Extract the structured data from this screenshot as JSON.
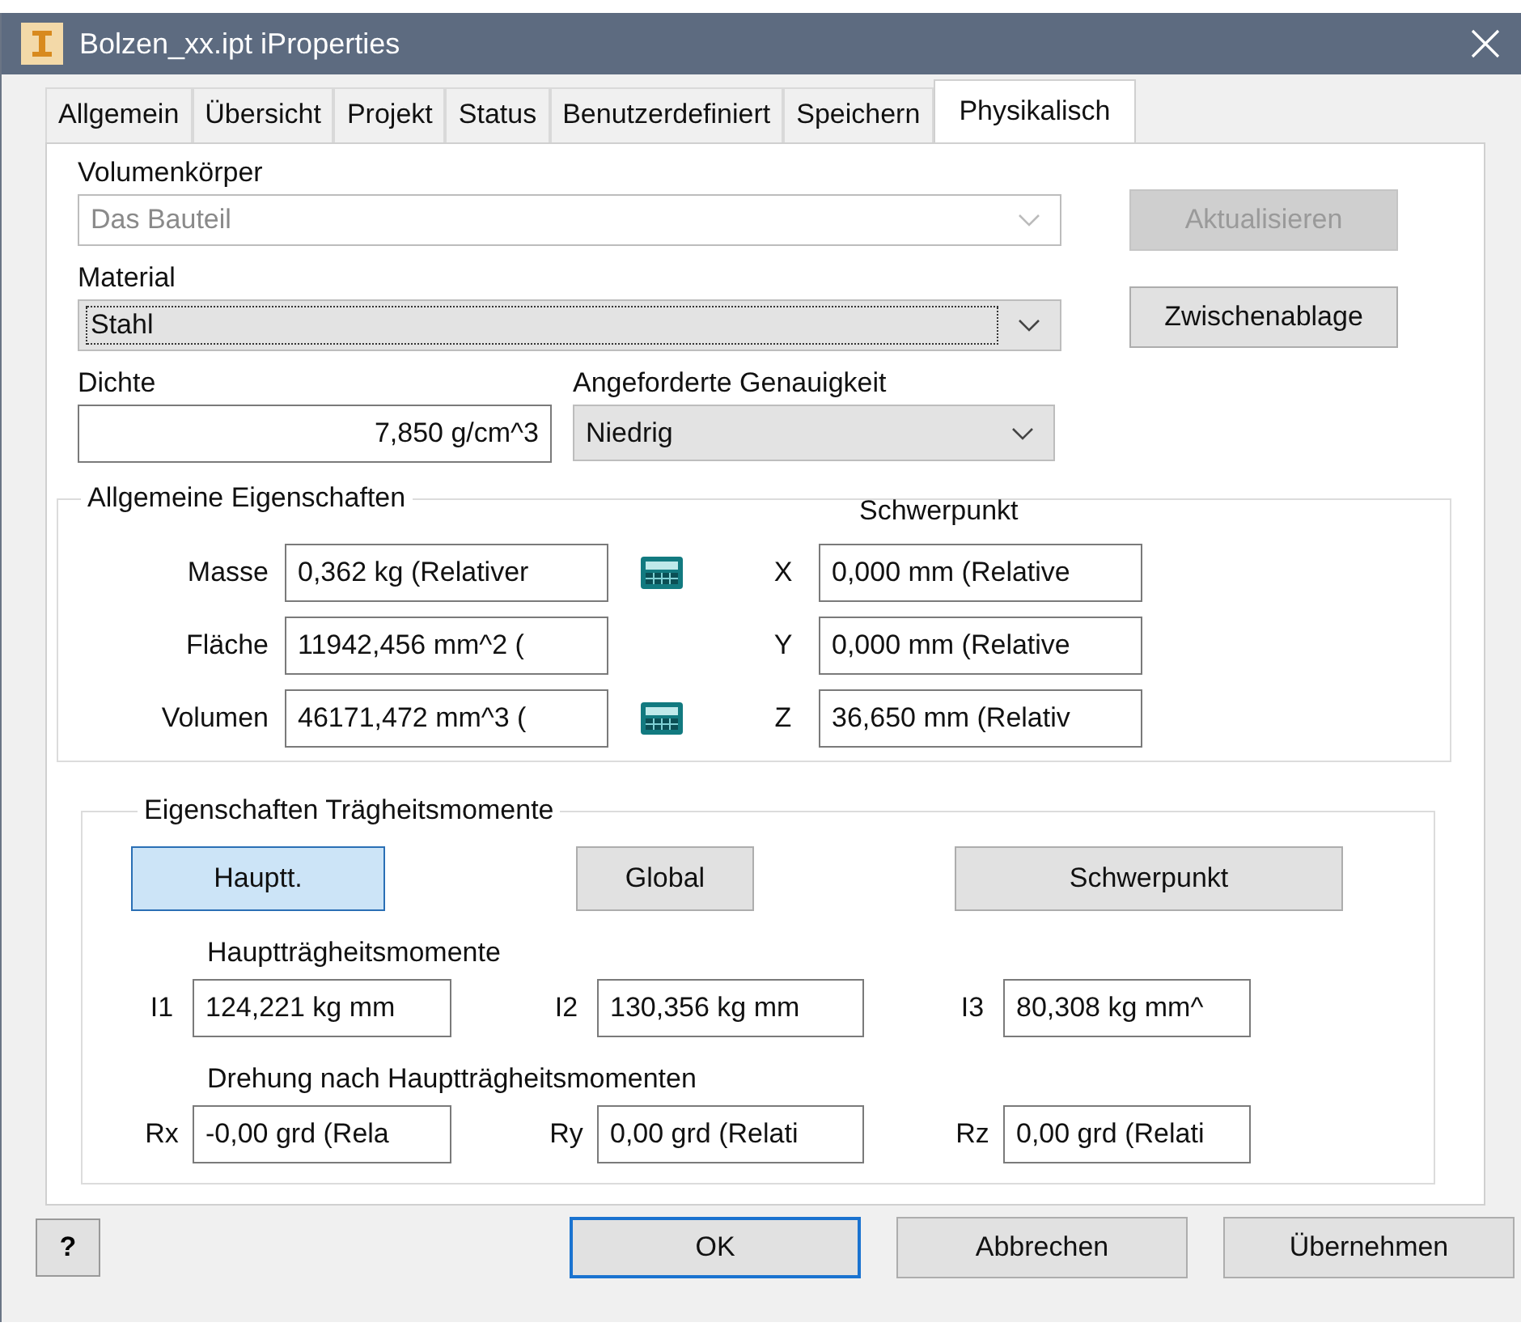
{
  "window": {
    "title": "Bolzen_xx.ipt iProperties"
  },
  "tabs": [
    {
      "label": "Allgemein",
      "selected": false
    },
    {
      "label": "Übersicht",
      "selected": false
    },
    {
      "label": "Projekt",
      "selected": false
    },
    {
      "label": "Status",
      "selected": false
    },
    {
      "label": "Benutzerdefiniert",
      "selected": false
    },
    {
      "label": "Speichern",
      "selected": false
    },
    {
      "label": "Physikalisch",
      "selected": true
    }
  ],
  "solid": {
    "label": "Volumenkörper",
    "value": "Das Bauteil",
    "disabled": true
  },
  "update_button": {
    "label": "Aktualisieren",
    "disabled": true
  },
  "material": {
    "label": "Material",
    "value": "Stahl",
    "focused": true
  },
  "clipboard_button": {
    "label": "Zwischenablage",
    "disabled": false
  },
  "density": {
    "label": "Dichte",
    "value": "7,850 g/cm^3"
  },
  "accuracy": {
    "label": "Angeforderte Genauigkeit",
    "value": "Niedrig"
  },
  "general": {
    "title": "Allgemeine Eigenschaften",
    "center_title": "Schwerpunkt",
    "rows": [
      {
        "label": "Masse",
        "value": "0,362 kg (Relativer",
        "calculator": true,
        "axis": "X",
        "center": "0,000 mm (Relative"
      },
      {
        "label": "Fläche",
        "value": "11942,456 mm^2 (",
        "axis": "Y",
        "center": "0,000 mm (Relative"
      },
      {
        "label": "Volumen",
        "value": "46171,472 mm^3 (",
        "calculator": true,
        "axis": "Z",
        "center": "36,650 mm (Relativ"
      }
    ]
  },
  "inertia": {
    "title": "Eigenschaften Trägheitsmomente",
    "modes": [
      {
        "label": "Hauptt.",
        "selected": true
      },
      {
        "label": "Global",
        "selected": false
      },
      {
        "label": "Schwerpunkt",
        "selected": false
      }
    ],
    "principal_title": "Hauptträgheitsmomente",
    "principal": [
      {
        "label": "I1",
        "value": "124,221 kg mm"
      },
      {
        "label": "I2",
        "value": "130,356 kg mm"
      },
      {
        "label": "I3",
        "value": "80,308 kg mm^"
      }
    ],
    "rotation_title": "Drehung nach Hauptträgheitsmomenten",
    "rotation": [
      {
        "label": "Rx",
        "value": "-0,00 grd (Rela"
      },
      {
        "label": "Ry",
        "value": "0,00 grd (Relati"
      },
      {
        "label": "Rz",
        "value": "0,00 grd (Relati"
      }
    ]
  },
  "help": {
    "symbol": "?"
  },
  "buttons": [
    {
      "label": "OK",
      "default": true
    },
    {
      "label": "Abbrechen",
      "default": false
    },
    {
      "label": "Übernehmen",
      "default": false
    }
  ]
}
